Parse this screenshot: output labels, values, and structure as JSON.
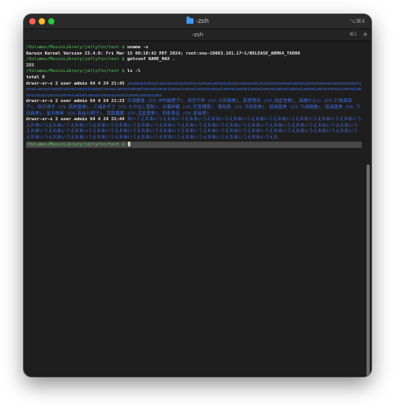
{
  "window": {
    "title": "-zsh",
    "shortcut": "⌥⌘4",
    "icon": "folder-icon"
  },
  "tab": {
    "title": "-zsh",
    "shortcut": "⌘1",
    "new_tab": "+"
  },
  "colors": {
    "background": "#1e1e1e",
    "prompt": "#51d051",
    "dir_name": "#3f6fe6",
    "text": "#e6e6e6"
  },
  "terminal": {
    "prompt": "/Volumes/MusicLibrary/jellyfin/test $",
    "cmd1": "uname -v",
    "out1": "Darwin Kernel Version 23.4.0: Fri Mar 15 00:10:42 PDT 2024; root:xnu-10063.101.17~1/RELEASE_ARM64_T6000",
    "cmd2": "getconf NAME_MAX .",
    "out2": "255",
    "cmd3": "ls -l",
    "total": "total 0",
    "entries": [
      {
        "meta": "drwxr-xr-x  2 user  admin  64  4 24 21:45",
        "name": "aiueoaiueoaiueoaiueoaiueoaiueoaiueoaiueoaiueoaiueoaiueoaiueoaiueoaiueoaiueoaiueoaiueoaiueoaiueoaiueoaiueoaiueoaiueoaiueoaiueoaiueoaiueoaiueoaiueoaiueoaiueoaiueoaiueoaiueoaiueoaiueoaiueoaiueoaiueoaiueoaiueoaiueoaiueoaiueoaiueoaiueoaiueoaiueoaiueoaiueoaiueoaiueoaiueo"
      },
      {
        "meta": "drwxr-xr-x  2 user  admin  64  4 24 21:23",
        "name": "天海春香 (CV.中村繪里子)、如月千早 (CV.今井麻美)、萩原雪歩 (CV.浅倉杏美)、高槻やよい (CV.仁後真耶子)、秋月律子 (CV.若林直美)、三浦あずさ (CV.たかはし智秋)、水瀬伊織 (CV.釘宮理恵)、菊地真 (CV.平田宏美)、双海亜美 (CV.下田麻美)、双海真美 (CV.下田麻美)、星井美希 (CV.長谷川明子)、我那覇響 (CV.沼倉愛美)、四条貴音 (CV.原由実)"
      },
      {
        "meta": "drwxr-xr-x  2 user  admin  64  4 24 21:44",
        "name": "あいうえおあいうえおあいうえおあいうえおあいうえおあいうえおあいうえおあいうえおあいうえおあいうえおあいうえおあいうえおあいうえおあいうえおあいうえおあいうえおあいうえおあいうえおあいうえおあいうえおあいうえおあいうえおあいうえおあいうえおあいうえおあいうえおあいうえおあいうえおあいうえおあいうえおあいうえおあいうえおあいうえおあいうえおあいうえおあいうえおあいうえおあいうえおあいうえおあいうえおあいうえおあいうえおあいうえおあいうえおあいうえおあいうえおあいうえおあいうえおあいうえおあいうえおあいうえおあいうえお"
      }
    ]
  }
}
